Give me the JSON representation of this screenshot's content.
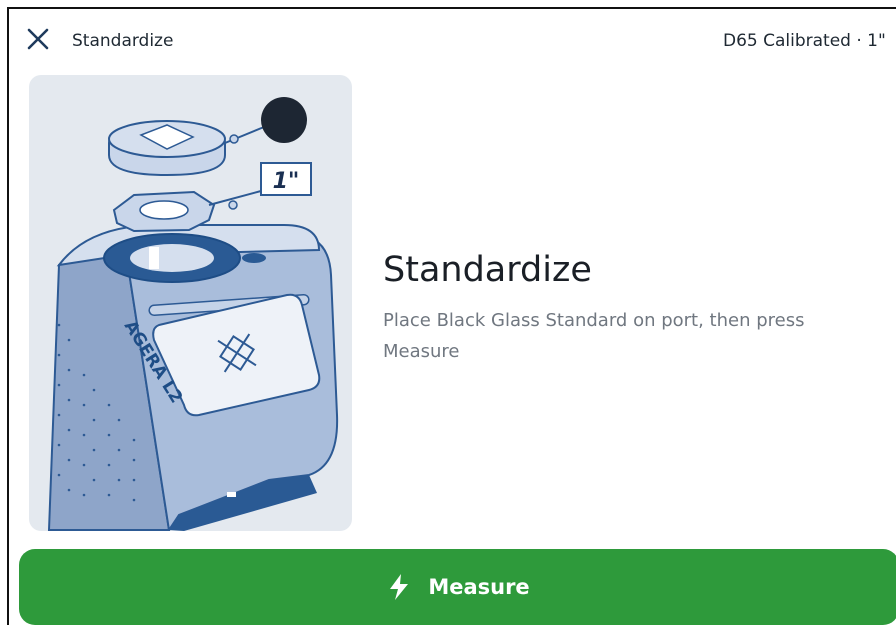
{
  "header": {
    "title": "Standardize",
    "status": "D65 Calibrated · 1\"",
    "close_icon": "close-icon"
  },
  "illustration": {
    "device_label": "AGERA L2",
    "port_size_label": "1\""
  },
  "content": {
    "title": "Standardize",
    "subtitle": "Place Black Glass Standard on port, then press Measure"
  },
  "footer": {
    "measure_label": "Measure",
    "measure_icon": "bolt-icon"
  },
  "colors": {
    "accent": "#2e9a3b",
    "illustration_background": "#e4e9ef",
    "device_blue": "#5b7fb4",
    "device_dark": "#1e4d86"
  }
}
